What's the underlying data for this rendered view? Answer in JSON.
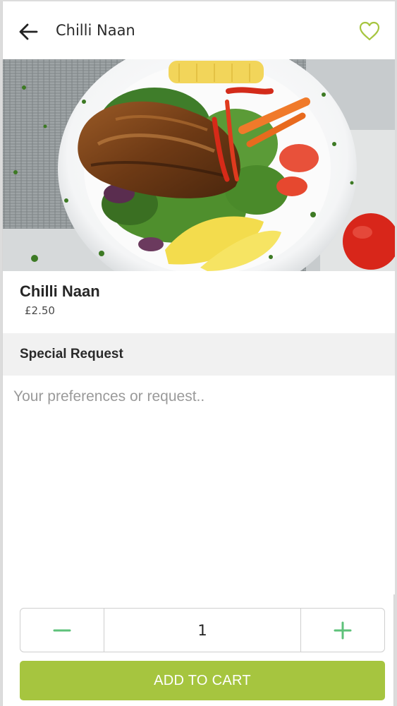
{
  "header": {
    "title": "Chilli Naan",
    "back_icon": "arrow-left-icon",
    "favorite_icon": "heart-outline-icon",
    "accent_color": "#a6c53f"
  },
  "item": {
    "name": "Chilli Naan",
    "price": "£2.50",
    "image": "grilled-chicken-salad-photo"
  },
  "special_request": {
    "heading": "Special Request",
    "placeholder": "Your preferences or request..",
    "value": ""
  },
  "quantity": {
    "value": "1",
    "decrement_icon": "minus-icon",
    "increment_icon": "plus-icon",
    "control_color": "#5ec27a"
  },
  "cart": {
    "button_label": "ADD TO CART",
    "button_color": "#a6c53f"
  }
}
